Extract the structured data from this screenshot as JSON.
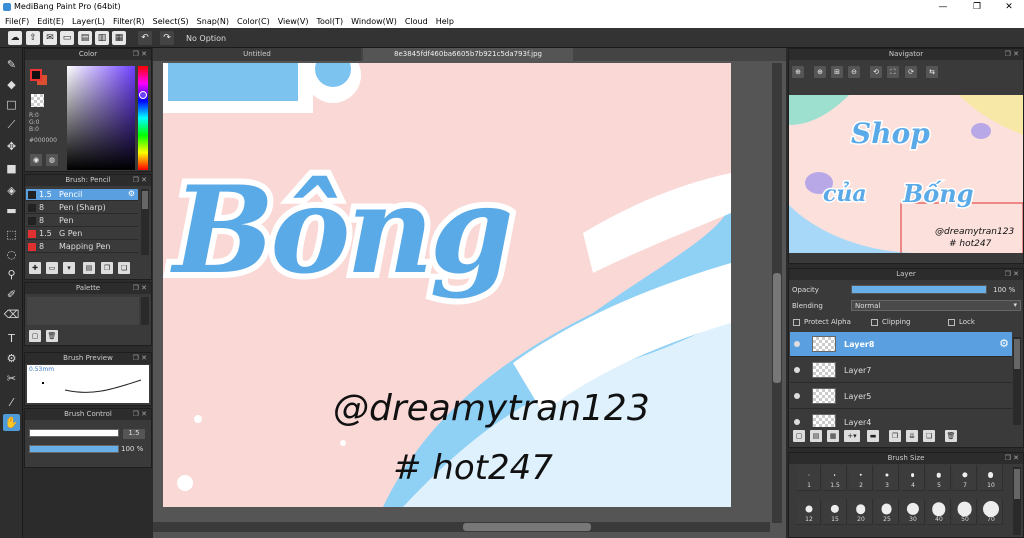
{
  "window": {
    "title": "MediBang Paint Pro (64bit)",
    "min": "—",
    "max": "❐",
    "close": "✕"
  },
  "menu": [
    "File(F)",
    "Edit(E)",
    "Layer(L)",
    "Filter(R)",
    "Select(S)",
    "Snap(N)",
    "Color(C)",
    "View(V)",
    "Tool(T)",
    "Window(W)",
    "Cloud",
    "Help"
  ],
  "toolbar": {
    "option_text": "No Option"
  },
  "color_panel": {
    "title": "Color",
    "r": "R:0",
    "g": "G:0",
    "b": "B:0",
    "hex": "#000000",
    "fg_color": "#000000",
    "bg_color": "#d85030"
  },
  "brush_panel": {
    "title": "Brush: Pencil",
    "items": [
      {
        "size": "1.5",
        "name": "Pencil",
        "color": "#222222"
      },
      {
        "size": "8",
        "name": "Pen (Sharp)",
        "color": "#222222"
      },
      {
        "size": "8",
        "name": "Pen",
        "color": "#222222"
      },
      {
        "size": "1.5",
        "name": "G Pen",
        "color": "#e03030"
      },
      {
        "size": "8",
        "name": "Mapping Pen",
        "color": "#e03030"
      }
    ]
  },
  "palette_panel": {
    "title": "Palette"
  },
  "preview_panel": {
    "title": "Brush Preview",
    "size": "0.53mm"
  },
  "control_panel": {
    "title": "Brush Control",
    "size": "1.5",
    "opacity": "100 %",
    "size_fraction": 1.0,
    "opacity_fraction": 1.0
  },
  "tabs": [
    "Untitled",
    "8e3845fdf460ba6605b7b921c5da793f.jpg"
  ],
  "artwork": {
    "line1": "Bông",
    "handle": "@dreamytran123",
    "tag": "# hot247"
  },
  "navigator": {
    "title": "Navigator",
    "text1": "Shop",
    "text2": "của",
    "text3": "Bống",
    "text4": "@dreamytran123",
    "text5": "# hot247"
  },
  "layer_panel": {
    "title": "Layer",
    "opacity_label": "Opacity",
    "opacity_value": "100 %",
    "opacity_fraction": 1.0,
    "blending_label": "Blending",
    "blending_value": "Normal",
    "protect_alpha": "Protect Alpha",
    "clipping": "Clipping",
    "lock": "Lock",
    "layers": [
      "Layer8",
      "Layer7",
      "Layer5",
      "Layer4"
    ]
  },
  "size_panel": {
    "title": "Brush Size",
    "row1": [
      "1",
      "1.5",
      "2",
      "3",
      "4",
      "5",
      "7",
      "10"
    ],
    "row2": [
      "12",
      "15",
      "20",
      "25",
      "30",
      "40",
      "50",
      "70"
    ]
  }
}
